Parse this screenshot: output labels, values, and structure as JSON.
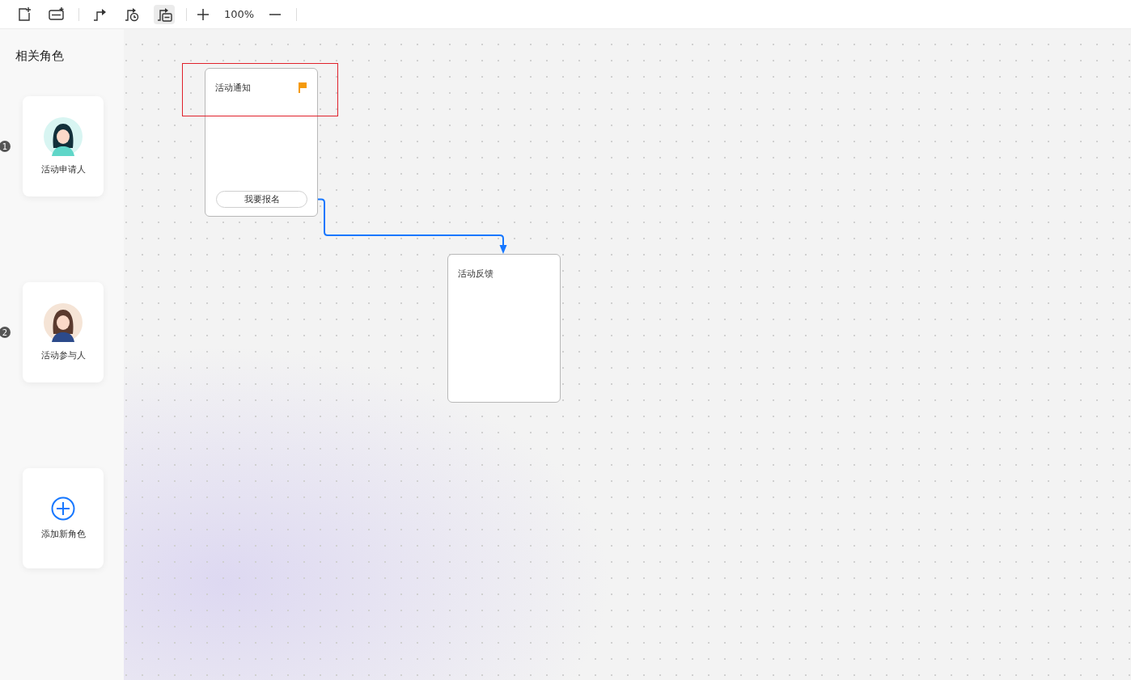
{
  "toolbar": {
    "tools": [
      {
        "kind": "add-node",
        "selected": false
      },
      {
        "kind": "add-button",
        "selected": false
      },
      {
        "kind": "link",
        "selected": false
      },
      {
        "kind": "timed-link",
        "selected": false
      },
      {
        "kind": "button-link",
        "selected": true
      }
    ],
    "zoom_level": "100%"
  },
  "sidebar": {
    "title": "相关角色",
    "roles": [
      {
        "kind": "role",
        "number": "1",
        "name": "活动申请人",
        "color": "#d8f5f2"
      },
      {
        "kind": "role",
        "number": "2",
        "name": "活动参与人",
        "color": "#f5e4d6"
      },
      {
        "kind": "add",
        "name": "添加新角色"
      }
    ]
  },
  "canvas": {
    "nodes": [
      {
        "title": "活动通知",
        "flagged": true,
        "selected": true,
        "button": "我要报名"
      },
      {
        "title": "活动反馈",
        "flagged": false,
        "selected": false
      }
    ]
  }
}
